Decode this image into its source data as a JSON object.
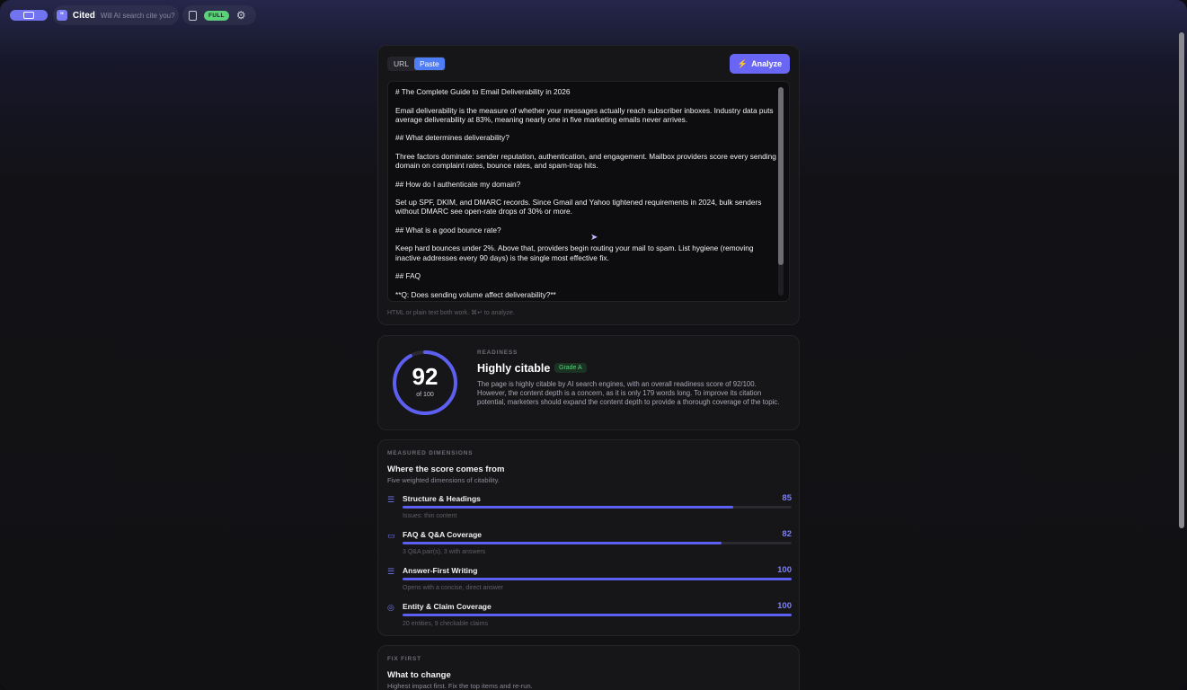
{
  "header": {
    "brand_name": "Cited",
    "brand_tagline": "Will AI search cite you?",
    "mode_badge": "FULL",
    "icons": [
      "app-toggle-icon",
      "quote-logo-icon",
      "book-icon",
      "gear-icon"
    ]
  },
  "input": {
    "tabs": [
      {
        "label": "URL",
        "active": false
      },
      {
        "label": "Paste",
        "active": true
      }
    ],
    "analyze_label": "Analyze",
    "content": "# The Complete Guide to Email Deliverability in 2026\n\nEmail deliverability is the measure of whether your messages actually reach subscriber inboxes. Industry data puts average deliverability at 83%, meaning nearly one in five marketing emails never arrives.\n\n## What determines deliverability?\n\nThree factors dominate: sender reputation, authentication, and engagement. Mailbox providers score every sending domain on complaint rates, bounce rates, and spam-trap hits.\n\n## How do I authenticate my domain?\n\nSet up SPF, DKIM, and DMARC records. Since Gmail and Yahoo tightened requirements in 2024, bulk senders without DMARC see open-rate drops of 30% or more.\n\n## What is a good bounce rate?\n\nKeep hard bounces under 2%. Above that, providers begin routing your mail to spam. List hygiene (removing inactive addresses every 90 days) is the single most effective fix.\n\n## FAQ\n\n**Q: Does sending volume affect deliverability?**",
    "hint": "HTML or plain text both work. ⌘↵ to analyze."
  },
  "readiness": {
    "score": 92,
    "score_sub": "of 100",
    "eyebrow": "READINESS",
    "title": "Highly citable",
    "grade": "Grade A",
    "description": "The page is highly citable by AI search engines, with an overall readiness score of 92/100. However, the content depth is a concern, as it is only 179 words long. To improve its citation potential, marketers should expand the content depth to provide a thorough coverage of the topic.",
    "accent": "#5d5ff0"
  },
  "dimensions": {
    "eyebrow": "MEASURED DIMENSIONS",
    "title": "Where the score comes from",
    "subtitle": "Five weighted dimensions of citability.",
    "items": [
      {
        "label": "Structure & Headings",
        "score": "85",
        "value": 85,
        "note": "Issues: thin content",
        "icon": "list-icon"
      },
      {
        "label": "FAQ & Q&A Coverage",
        "score": "82",
        "value": 82,
        "note": "3 Q&A pair(s), 3 with answers",
        "icon": "chat-icon"
      },
      {
        "label": "Answer-First Writing",
        "score": "100",
        "value": 100,
        "note": "Opens with a concise, direct answer",
        "icon": "list-icon"
      },
      {
        "label": "Entity & Claim Coverage",
        "score": "100",
        "value": 100,
        "note": "20 entities, 9 checkable claims",
        "icon": "check-circle-icon"
      }
    ]
  },
  "fix": {
    "eyebrow": "FIX FIRST",
    "title": "What to change",
    "subtitle": "Highest impact first. Fix the top items and re-run."
  }
}
